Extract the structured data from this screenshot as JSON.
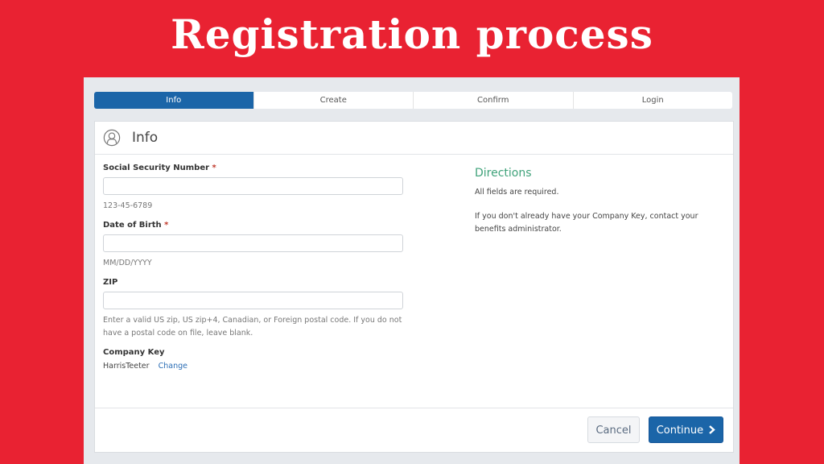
{
  "banner": {
    "title": "Registration process"
  },
  "steps": [
    {
      "label": "Info",
      "active": true
    },
    {
      "label": "Create",
      "active": false
    },
    {
      "label": "Confirm",
      "active": false
    },
    {
      "label": "Login",
      "active": false
    }
  ],
  "card": {
    "title": "Info",
    "icon": "user-icon"
  },
  "form": {
    "ssn": {
      "label": "Social Security Number",
      "required": "*",
      "value": "",
      "hint": "123-45-6789"
    },
    "dob": {
      "label": "Date of Birth",
      "required": "*",
      "value": "",
      "hint": "MM/DD/YYYY"
    },
    "zip": {
      "label": "ZIP",
      "value": "",
      "hint": "Enter a valid US zip, US zip+4, Canadian, or Foreign postal code. If you do not have a postal code on file, leave blank."
    },
    "company_key": {
      "label": "Company Key",
      "value": "HarrisTeeter",
      "change_link": "Change"
    }
  },
  "directions": {
    "title": "Directions",
    "lines": [
      "All fields are required.",
      "If you don't already have your Company Key, contact your benefits administrator."
    ]
  },
  "footer": {
    "cancel_label": "Cancel",
    "continue_label": "Continue",
    "continue_icon": "chevron-right-icon"
  },
  "colors": {
    "background": "#e92232",
    "primary": "#1b65a8",
    "directions": "#3fa27a",
    "link": "#2a6db5"
  }
}
